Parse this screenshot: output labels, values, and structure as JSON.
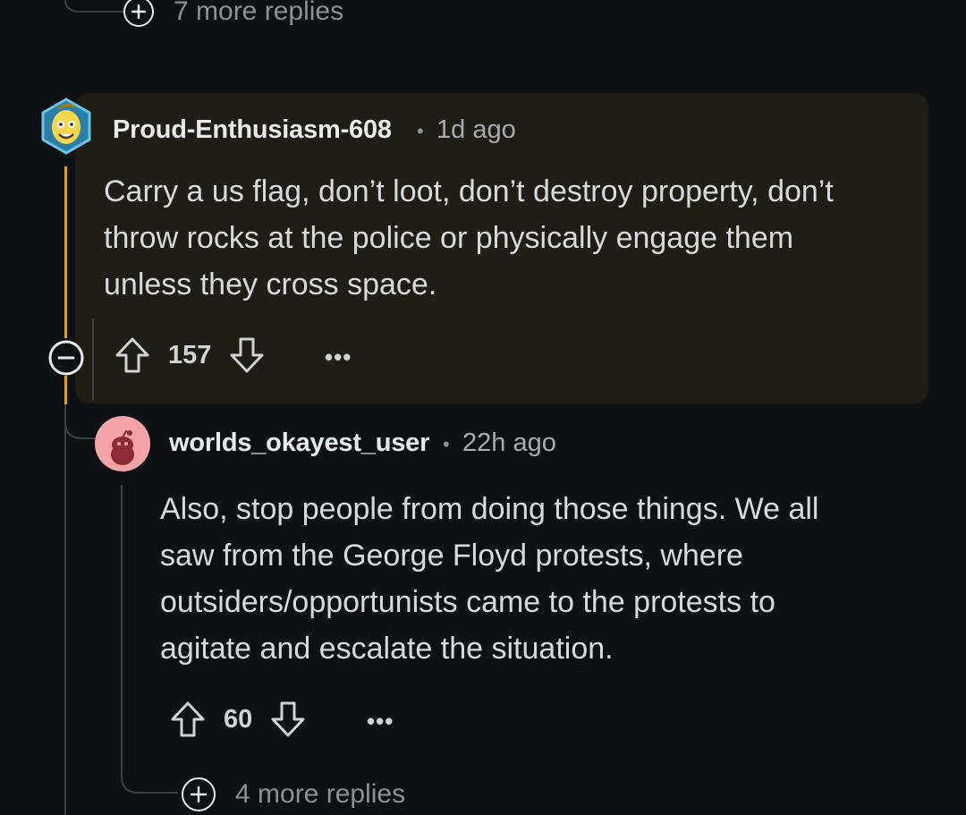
{
  "top_more_replies": {
    "label": "7 more replies"
  },
  "comment1": {
    "username": "Proud-Enthusiasm-608",
    "separator": "•",
    "timestamp": "1d ago",
    "body_lines": [
      "Carry a us flag, don’t loot, don’t destroy property, don’t",
      "throw rocks at the police or physically engage them",
      "unless they cross space."
    ],
    "score": "157",
    "more_label": "•••",
    "highlight_color": "#1f1d16",
    "thread_accent_color": "#d9a227"
  },
  "comment2": {
    "username": "worlds_okayest_user",
    "separator": "•",
    "timestamp": "22h ago",
    "body_lines": [
      "Also, stop people from doing those things. We all",
      "saw from the George Floyd protests, where",
      "outsiders/opportunists came to the protests to",
      "agitate and escalate the situation."
    ],
    "score": "60",
    "more_label": "•••"
  },
  "bottom_more_replies": {
    "label": "4 more replies"
  },
  "icons": {
    "expand": "plus-circle-icon",
    "collapse": "minus-circle-icon",
    "upvote": "arrow-up-icon",
    "downvote": "arrow-down-icon",
    "more": "more-icon"
  }
}
